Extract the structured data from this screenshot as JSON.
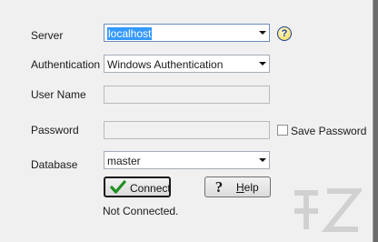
{
  "form": {
    "server": {
      "label": "Server",
      "value": "localhost"
    },
    "authentication": {
      "label": "Authentication",
      "value": "Windows Authentication"
    },
    "username": {
      "label": "User Name",
      "value": ""
    },
    "password": {
      "label": "Password",
      "value": ""
    },
    "save_password": {
      "label": "Save Password",
      "checked": false
    },
    "database": {
      "label": "Database",
      "value": "master"
    }
  },
  "buttons": {
    "connect": "Connect",
    "help_prefix": "H",
    "help_rest": "elp"
  },
  "help_icon": {
    "glyph": "?",
    "name": "question-icon"
  },
  "status": "Not Connected.",
  "colors": {
    "selection": "#3399ff",
    "check_green": "#1f8f1f"
  }
}
